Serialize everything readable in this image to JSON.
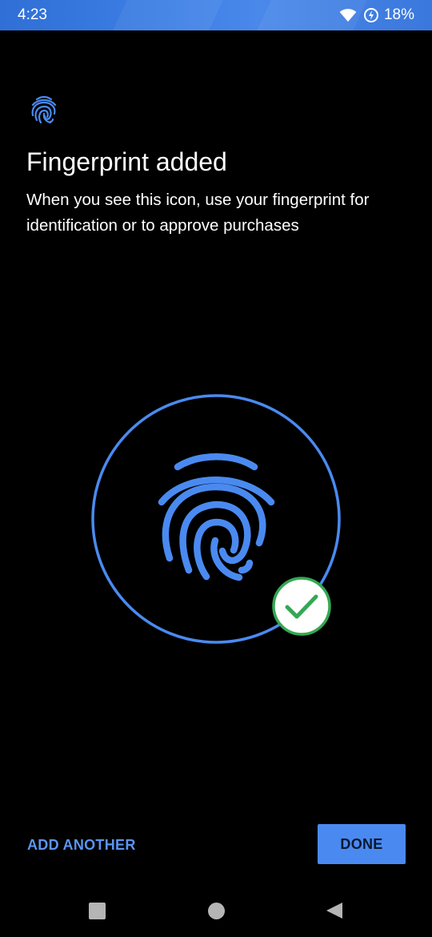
{
  "status_bar": {
    "time": "4:23",
    "battery_percent": "18%",
    "icons": [
      "wifi-icon",
      "battery-saver-icon"
    ],
    "background_color": "#3b7ae0"
  },
  "header": {
    "icon": "fingerprint-icon",
    "title": "Fingerprint added",
    "subtitle": "When you see this icon, use your fingerprint for identification or to approve purchases"
  },
  "illustration": {
    "icon": "fingerprint-icon",
    "badge_icon": "checkmark-icon",
    "accent_color": "#4a8af0",
    "success_color": "#34a853"
  },
  "actions": {
    "secondary_label": "ADD ANOTHER",
    "primary_label": "DONE"
  },
  "nav_bar": {
    "items": [
      "recents-icon",
      "home-icon",
      "back-icon"
    ]
  }
}
